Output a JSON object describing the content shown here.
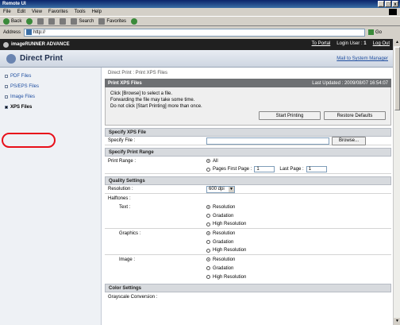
{
  "window": {
    "title": "Remote UI",
    "buttons": [
      "_",
      "□",
      "x"
    ]
  },
  "menubar": [
    "File",
    "Edit",
    "View",
    "Favorites",
    "Tools",
    "Help"
  ],
  "toolbar": {
    "back": "Back",
    "search": "Search",
    "favorites": "Favorites"
  },
  "address": {
    "label": "Address",
    "url": "http://",
    "go": "Go"
  },
  "brand": {
    "name": "imageRUNNER ADVANCE"
  },
  "portal": {
    "to_portal": "To Portal",
    "login_user": "Login User :",
    "logout": "Log Out"
  },
  "header": {
    "title": "Direct Print",
    "mail": "Mail to System Manager"
  },
  "sidebar": {
    "items": [
      {
        "label": "PDF Files"
      },
      {
        "label": "PS/EPS Files"
      },
      {
        "label": "Image Files"
      },
      {
        "label": "XPS Files"
      }
    ]
  },
  "breadcrumb": "Direct Print : Print XPS Files",
  "print_box": {
    "title": "Print XPS Files",
    "updated": "Last Updated : 2009/08/07 16:54:07",
    "instructions": [
      "Click [Browse] to select a file.",
      "Forwarding the file may take some time.",
      "Do not click [Start Printing] more than once."
    ],
    "start": "Start Printing",
    "restore": "Restore Defaults"
  },
  "specify_file": {
    "header": "Specify XPS File",
    "label": "Specify File :",
    "browse": "Browse..."
  },
  "print_range": {
    "header": "Specify Print Range",
    "label": "Print Range :",
    "all": "All",
    "pages": "Pages First Page :",
    "first_value": "1",
    "last_label": "Last Page :",
    "last_value": "1"
  },
  "quality": {
    "header": "Quality Settings",
    "resolution_label": "Resolution :",
    "resolution_value": "600 dpi",
    "halftones_label": "Halftones :",
    "text_label": "Text :",
    "graphics_label": "Graphics :",
    "image_label": "Image :",
    "options": [
      "Resolution",
      "Gradation",
      "High Resolution"
    ]
  },
  "color": {
    "header": "Color Settings",
    "grayscale_label": "Grayscale Conversion :"
  }
}
